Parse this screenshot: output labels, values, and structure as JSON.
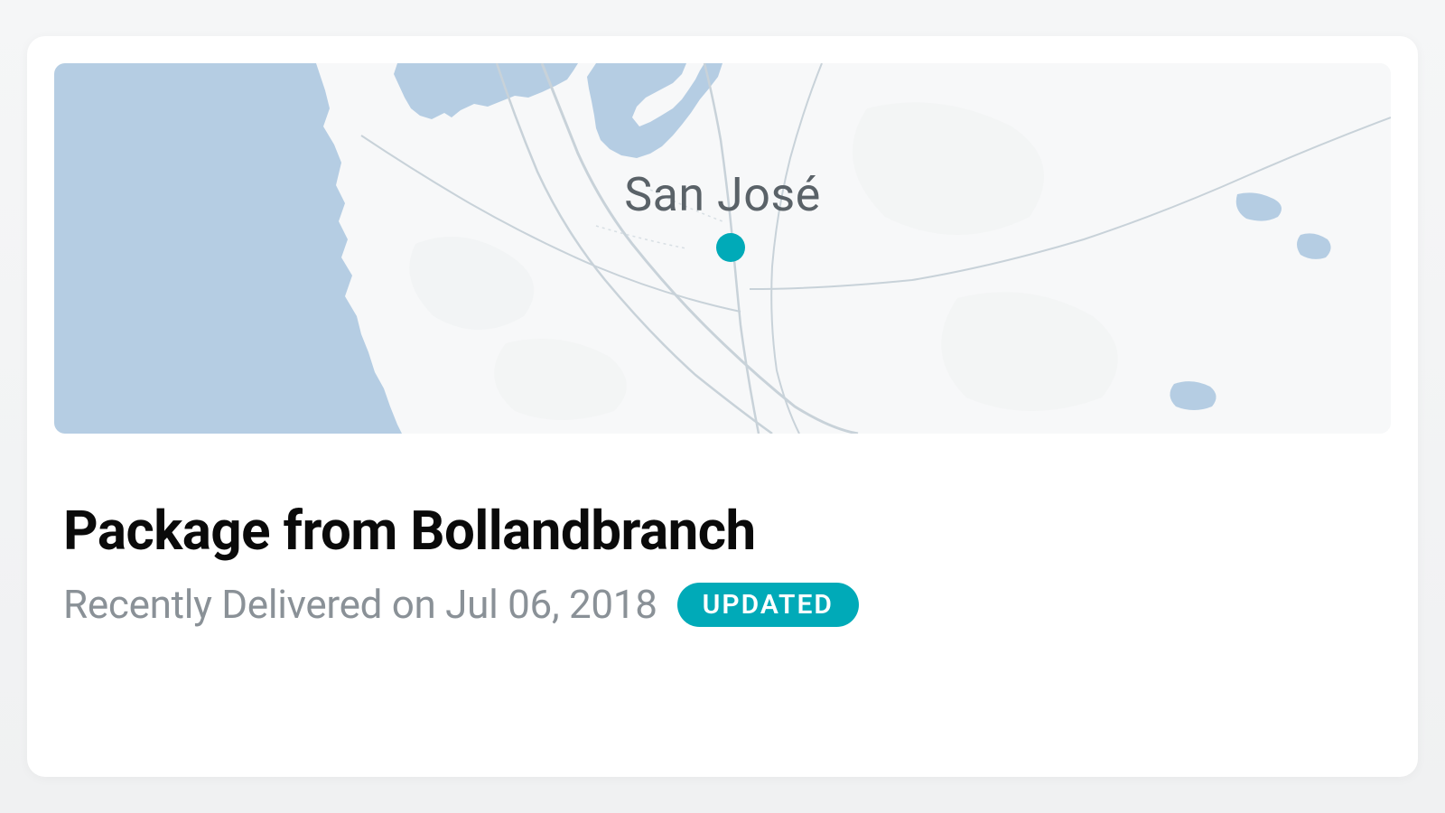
{
  "map": {
    "city_label": "San José",
    "marker_color": "#00aab8",
    "ocean_color": "#b3cde5",
    "land_color": "#f7f8f9",
    "road_color": "#dce3e8"
  },
  "package": {
    "title": "Package from Bollandbranch",
    "status_text": "Recently Delivered on Jul 06, 2018",
    "badge_label": "UPDATED",
    "badge_color": "#00aab8"
  }
}
